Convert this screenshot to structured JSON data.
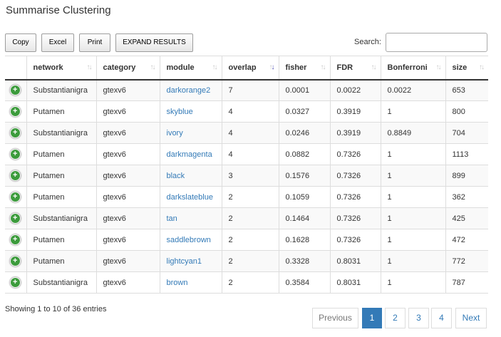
{
  "page": {
    "title": "Summarise Clustering"
  },
  "toolbar": {
    "copy_label": "Copy",
    "excel_label": "Excel",
    "print_label": "Print",
    "expand_label": "EXPAND RESULTS"
  },
  "search": {
    "label": "Search:",
    "value": ""
  },
  "table": {
    "columns": [
      "",
      "network",
      "category",
      "module",
      "overlap",
      "fisher",
      "FDR",
      "Bonferroni",
      "size"
    ],
    "sorted_column": "overlap",
    "sort_direction": "descending",
    "rows": [
      {
        "network": "Substantianigra",
        "category": "gtexv6",
        "module": "darkorange2",
        "overlap": "7",
        "fisher": "0.0001",
        "fdr": "0.0022",
        "bonferroni": "0.0022",
        "size": "653"
      },
      {
        "network": "Putamen",
        "category": "gtexv6",
        "module": "skyblue",
        "overlap": "4",
        "fisher": "0.0327",
        "fdr": "0.3919",
        "bonferroni": "1",
        "size": "800"
      },
      {
        "network": "Substantianigra",
        "category": "gtexv6",
        "module": "ivory",
        "overlap": "4",
        "fisher": "0.0246",
        "fdr": "0.3919",
        "bonferroni": "0.8849",
        "size": "704"
      },
      {
        "network": "Putamen",
        "category": "gtexv6",
        "module": "darkmagenta",
        "overlap": "4",
        "fisher": "0.0882",
        "fdr": "0.7326",
        "bonferroni": "1",
        "size": "1113"
      },
      {
        "network": "Putamen",
        "category": "gtexv6",
        "module": "black",
        "overlap": "3",
        "fisher": "0.1576",
        "fdr": "0.7326",
        "bonferroni": "1",
        "size": "899"
      },
      {
        "network": "Putamen",
        "category": "gtexv6",
        "module": "darkslateblue",
        "overlap": "2",
        "fisher": "0.1059",
        "fdr": "0.7326",
        "bonferroni": "1",
        "size": "362"
      },
      {
        "network": "Substantianigra",
        "category": "gtexv6",
        "module": "tan",
        "overlap": "2",
        "fisher": "0.1464",
        "fdr": "0.7326",
        "bonferroni": "1",
        "size": "425"
      },
      {
        "network": "Putamen",
        "category": "gtexv6",
        "module": "saddlebrown",
        "overlap": "2",
        "fisher": "0.1628",
        "fdr": "0.7326",
        "bonferroni": "1",
        "size": "472"
      },
      {
        "network": "Putamen",
        "category": "gtexv6",
        "module": "lightcyan1",
        "overlap": "2",
        "fisher": "0.3328",
        "fdr": "0.8031",
        "bonferroni": "1",
        "size": "772"
      },
      {
        "network": "Substantianigra",
        "category": "gtexv6",
        "module": "brown",
        "overlap": "2",
        "fisher": "0.3584",
        "fdr": "0.8031",
        "bonferroni": "1",
        "size": "787"
      }
    ]
  },
  "footer": {
    "info": "Showing 1 to 10 of 36 entries",
    "pagination": {
      "previous": "Previous",
      "pages": [
        "1",
        "2",
        "3",
        "4"
      ],
      "current": "1",
      "next": "Next"
    }
  },
  "colors": {
    "link": "#337ab7",
    "expand_icon": "#3c9b3c",
    "active_page": "#337ab7"
  }
}
